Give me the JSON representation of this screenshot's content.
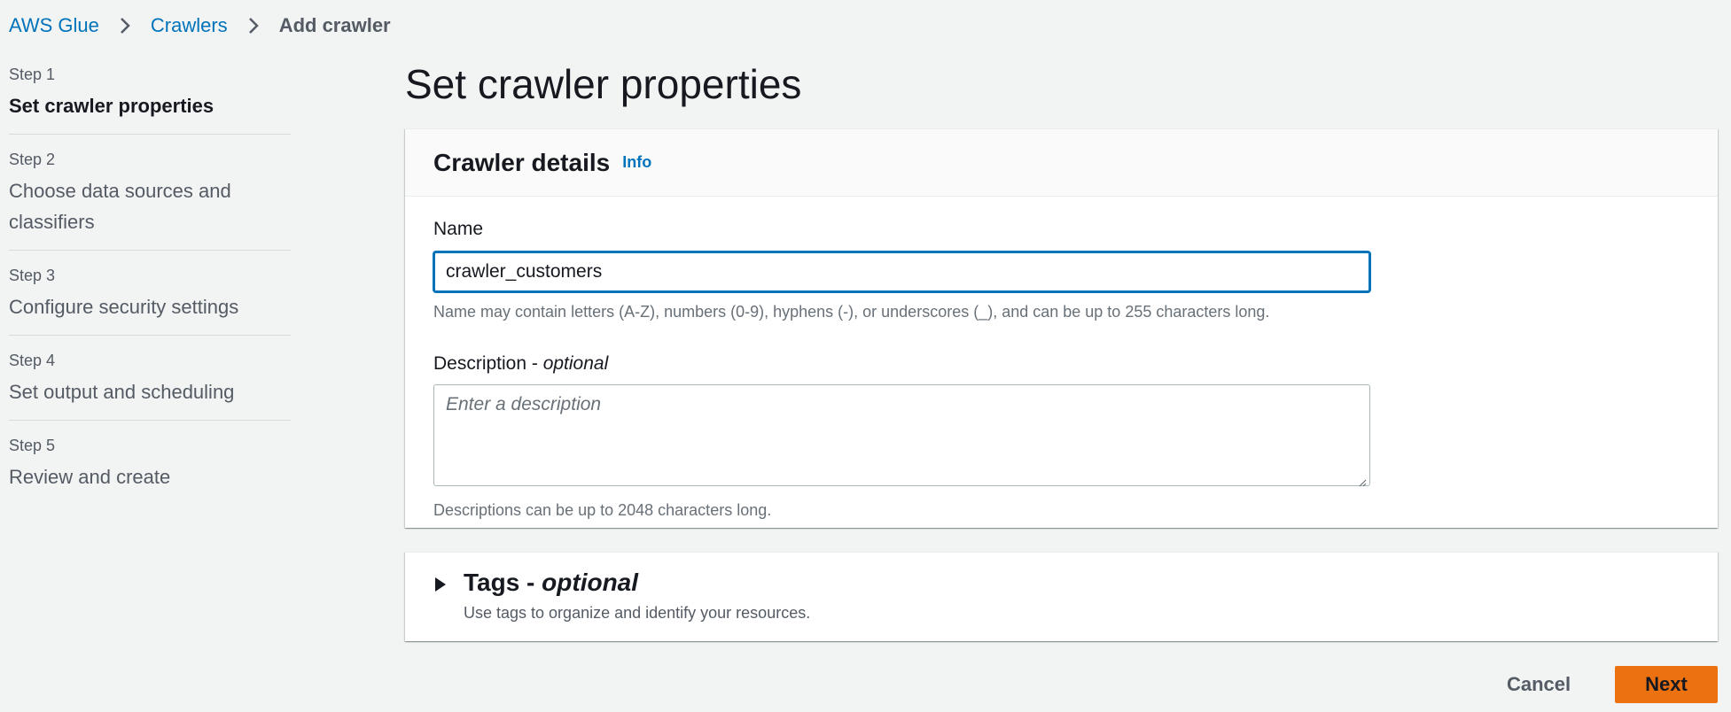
{
  "breadcrumb": {
    "items": [
      {
        "label": "AWS Glue"
      },
      {
        "label": "Crawlers"
      },
      {
        "label": "Add crawler"
      }
    ]
  },
  "steps": [
    {
      "number": "Step 1",
      "title": "Set crawler properties",
      "active": true
    },
    {
      "number": "Step 2",
      "title": "Choose data sources and classifiers",
      "active": false
    },
    {
      "number": "Step 3",
      "title": "Configure security settings",
      "active": false
    },
    {
      "number": "Step 4",
      "title": "Set output and scheduling",
      "active": false
    },
    {
      "number": "Step 5",
      "title": "Review and create",
      "active": false
    }
  ],
  "page": {
    "title": "Set crawler properties"
  },
  "details": {
    "title": "Crawler details",
    "info_link": "Info",
    "name": {
      "label": "Name",
      "value": "crawler_customers",
      "hint": "Name may contain letters (A-Z), numbers (0-9), hyphens (-), or underscores (_), and can be up to 255 characters long."
    },
    "description": {
      "label": "Description - ",
      "label_optional": "optional",
      "placeholder": "Enter a description",
      "hint": "Descriptions can be up to 2048 characters long."
    }
  },
  "tags": {
    "title": "Tags - ",
    "title_optional": "optional",
    "subtitle": "Use tags to organize and identify your resources.",
    "expanded": false
  },
  "actions": {
    "cancel_label": "Cancel",
    "next_label": "Next"
  },
  "colors": {
    "link": "#0073bb",
    "primary_button": "#ec7211",
    "focus_border": "#0073bb",
    "background": "#f2f3f3"
  }
}
